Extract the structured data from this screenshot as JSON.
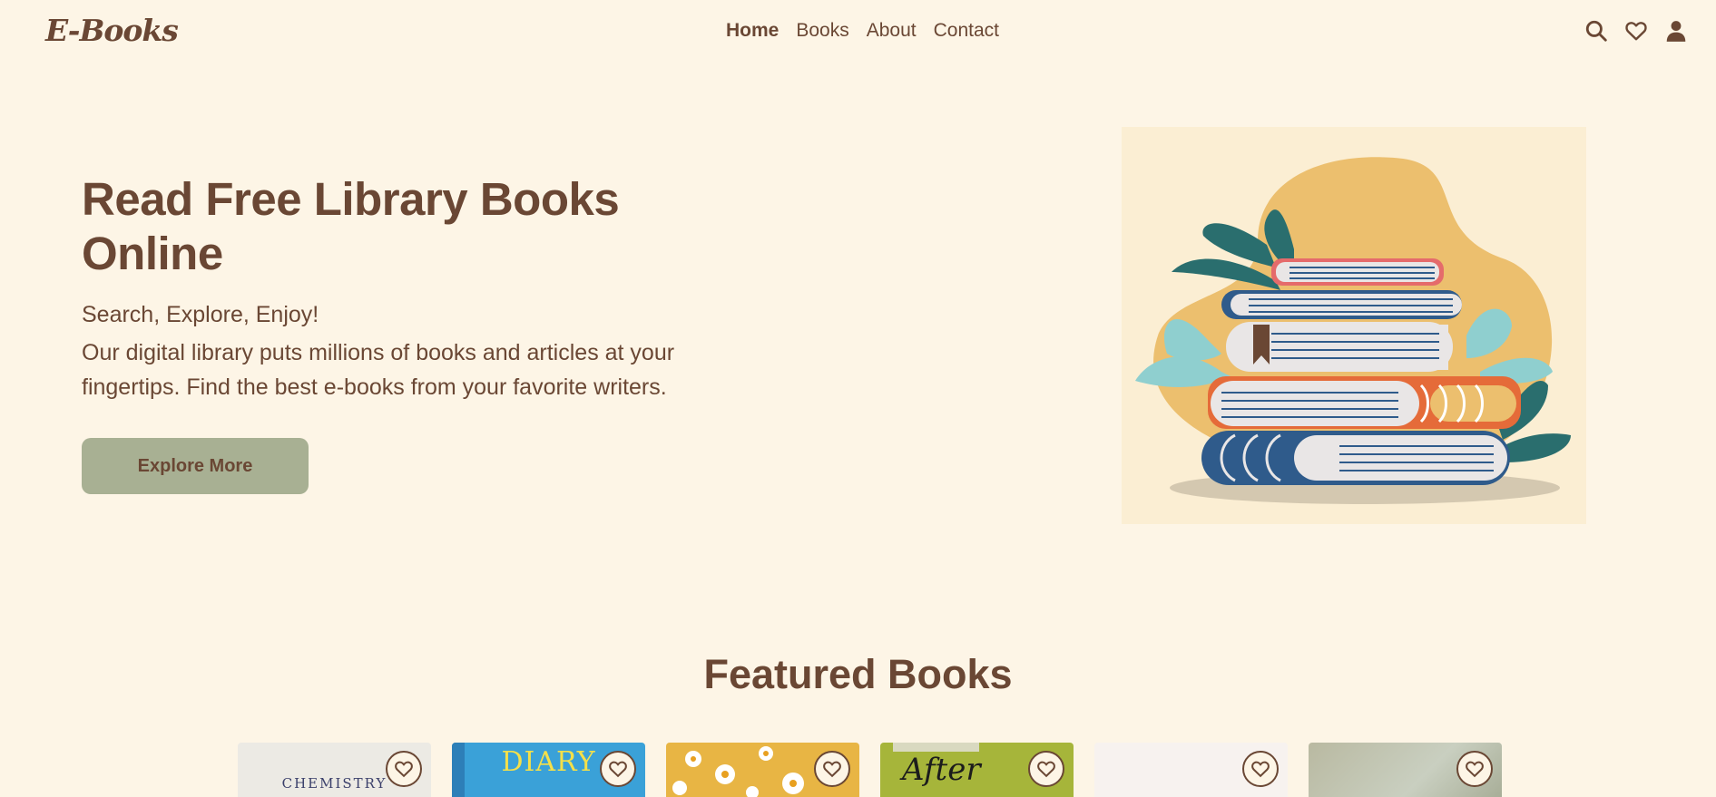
{
  "brand": {
    "logo": "E-Books"
  },
  "nav": {
    "links": [
      {
        "label": "Home",
        "active": true
      },
      {
        "label": "Books",
        "active": false
      },
      {
        "label": "About",
        "active": false
      },
      {
        "label": "Contact",
        "active": false
      }
    ],
    "icons": [
      "search-icon",
      "heart-icon",
      "user-icon"
    ]
  },
  "hero": {
    "title": "Read Free Library Books Online",
    "tagline": "Search, Explore, Enjoy!",
    "description": "Our digital library puts millions of books and articles at your fingertips. Find the best e-books from your favorite writers.",
    "button_label": "Explore More"
  },
  "featured": {
    "title": "Featured Books",
    "books": [
      {
        "cover_text": "CHEMISTRY",
        "cover_color": "#eceae4",
        "text_color": "#3a3f6a"
      },
      {
        "cover_text": "DIARY",
        "cover_color": "#3aa1d8",
        "text_color": "#f4e04a"
      },
      {
        "cover_text": "",
        "cover_color": "#e8b544",
        "text_color": "#ffffff"
      },
      {
        "cover_text": "After",
        "cover_color": "#a6b53a",
        "text_color": "#1c1c1c"
      },
      {
        "cover_text": "",
        "cover_color": "#f7f2ef",
        "text_color": "#999999"
      },
      {
        "cover_text": "",
        "cover_color": "#b9b9a1",
        "text_color": "#555555"
      }
    ]
  },
  "colors": {
    "background": "#fdf5e6",
    "primary_text": "#6a4734",
    "button": "#a8b093",
    "hero_panel": "#fbeed3"
  }
}
